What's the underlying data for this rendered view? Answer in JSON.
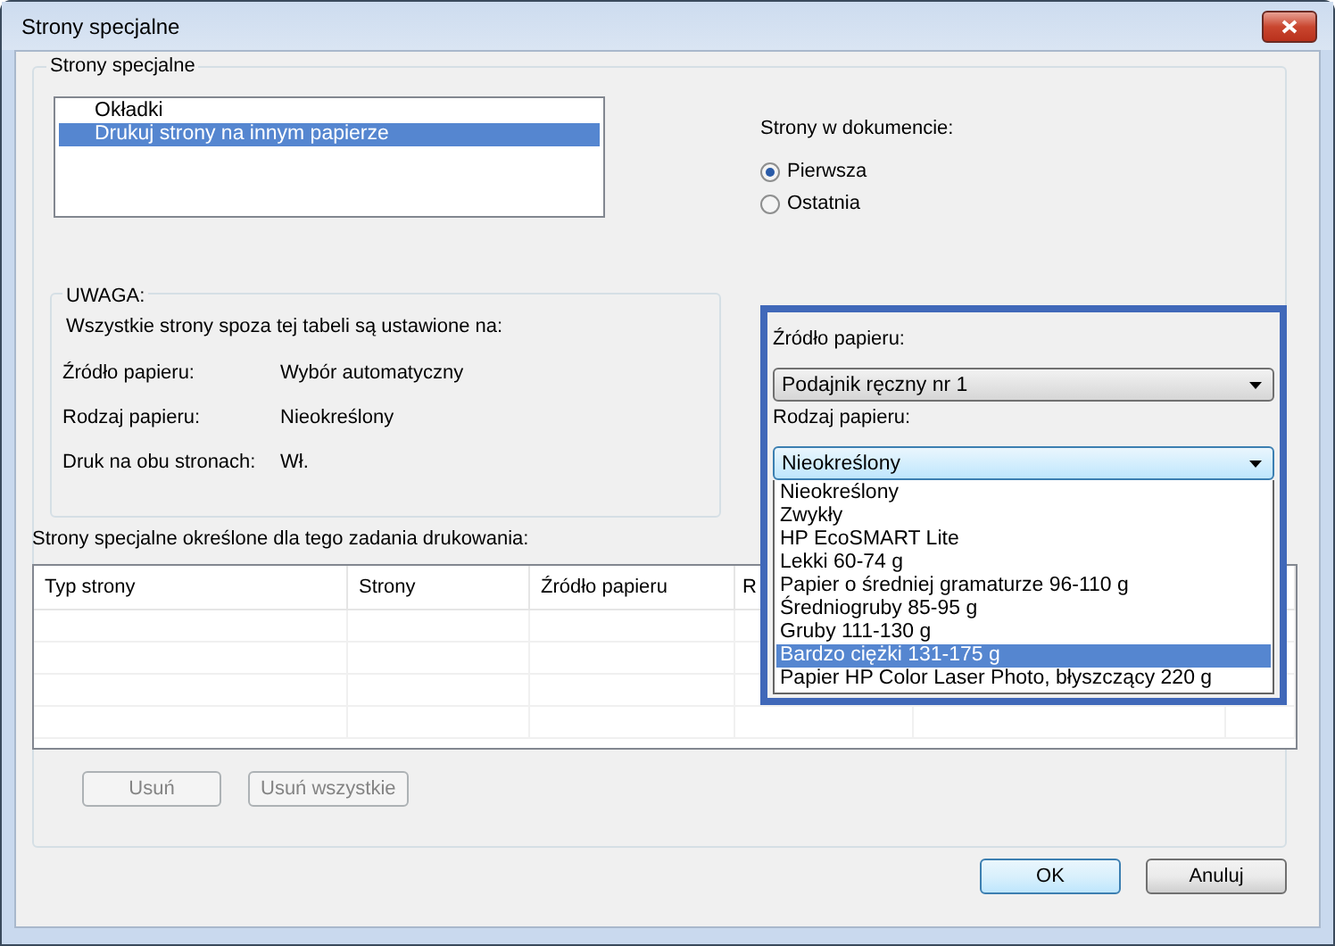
{
  "window": {
    "title": "Strony specjalne"
  },
  "special_pages": {
    "title": "Strony specjalne",
    "items": [
      {
        "label": "Okładki",
        "selected": false
      },
      {
        "label": "Drukuj strony na innym papierze",
        "selected": true
      }
    ]
  },
  "pages_in_document": {
    "label": "Strony w dokumencie:",
    "options": [
      {
        "label": "Pierwsza",
        "selected": true
      },
      {
        "label": "Ostatnia",
        "selected": false
      }
    ]
  },
  "note": {
    "title": "UWAGA:",
    "text": "Wszystkie strony spoza tej tabeli są ustawione na:",
    "rows": [
      {
        "label": "Źródło papieru:",
        "value": "Wybór automatyczny"
      },
      {
        "label": "Rodzaj papieru:",
        "value": "Nieokreślony"
      },
      {
        "label": "Druk na obu stronach:",
        "value": "Wł."
      }
    ]
  },
  "paper": {
    "source_label": "Źródło papieru:",
    "source_value": "Podajnik ręczny nr 1",
    "type_label": "Rodzaj papieru:",
    "type_value": "Nieokreślony",
    "type_options": [
      {
        "label": "Nieokreślony",
        "selected": false
      },
      {
        "label": "Zwykły",
        "selected": false
      },
      {
        "label": "HP EcoSMART Lite",
        "selected": false
      },
      {
        "label": "Lekki 60-74 g",
        "selected": false
      },
      {
        "label": "Papier o średniej gramaturze 96-110 g",
        "selected": false
      },
      {
        "label": "Średniogruby 85-95 g",
        "selected": false
      },
      {
        "label": "Gruby 111-130 g",
        "selected": false
      },
      {
        "label": "Bardzo ciężki 131-175 g",
        "selected": true
      },
      {
        "label": "Papier HP Color Laser Photo, błyszczący 220 g",
        "selected": false
      }
    ]
  },
  "table": {
    "caption": "Strony specjalne określone dla tego zadania drukowania:",
    "columns": [
      "Typ strony",
      "Strony",
      "Źródło papieru",
      "R"
    ]
  },
  "table_buttons": [
    {
      "label": "Usuń",
      "disabled": true
    },
    {
      "label": "Usuń wszystkie",
      "disabled": true
    }
  ],
  "buttons": [
    {
      "label": "OK",
      "default": true
    },
    {
      "label": "Anuluj",
      "default": false
    }
  ]
}
